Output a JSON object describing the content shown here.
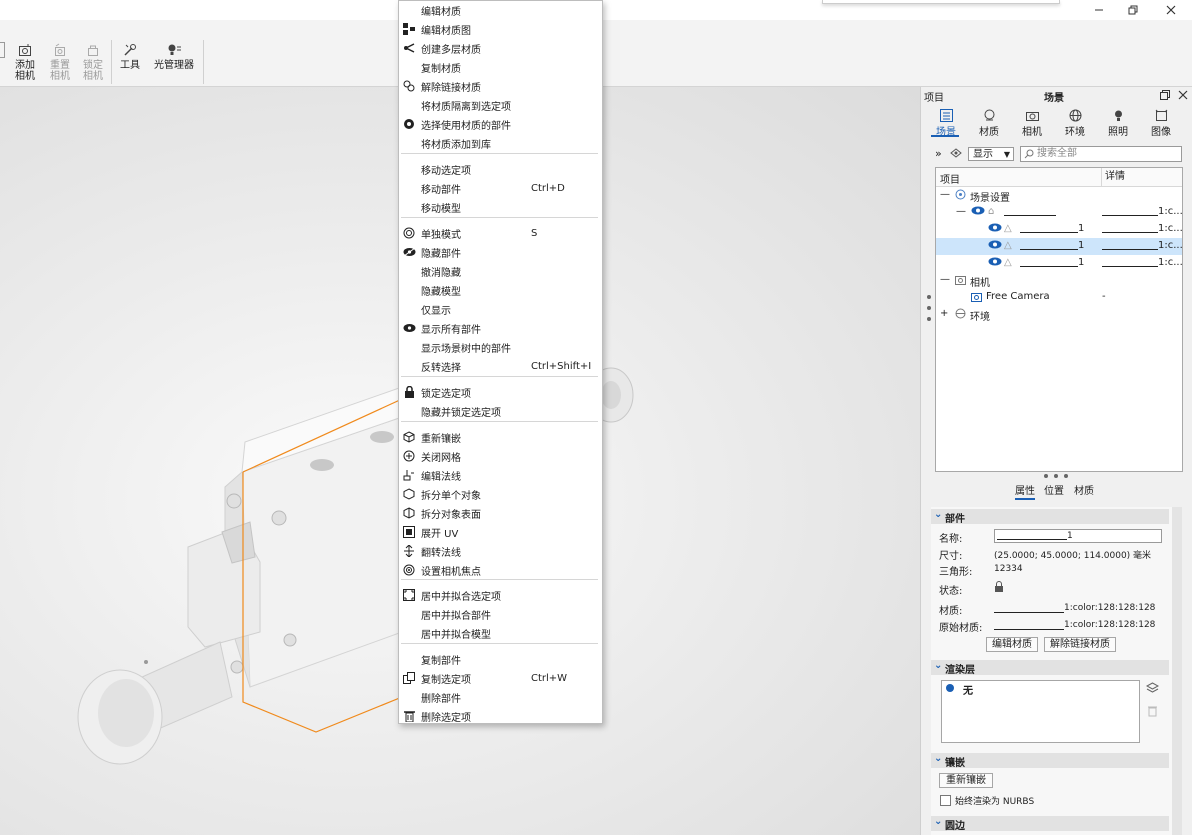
{
  "toolbar": {
    "buttons": [
      {
        "label": "添加相机",
        "icon": "add-camera-icon",
        "enabled": true
      },
      {
        "label": "重置相机",
        "icon": "reset-camera-icon",
        "enabled": false
      },
      {
        "label": "锁定相机",
        "icon": "lock-camera-icon",
        "enabled": false
      },
      {
        "label": "工具",
        "icon": "tools-icon",
        "enabled": true
      },
      {
        "label": "光管理器",
        "icon": "light-manager-icon",
        "enabled": true
      }
    ]
  },
  "context_menu": {
    "items": [
      {
        "label": "编辑材质",
        "icon": "",
        "shortcut": ""
      },
      {
        "label": "编辑材质图",
        "icon": "material-graph-icon",
        "shortcut": ""
      },
      {
        "label": "创建多层材质",
        "icon": "multilayer-icon",
        "shortcut": ""
      },
      {
        "label": "复制材质",
        "icon": "",
        "shortcut": ""
      },
      {
        "label": "解除链接材质",
        "icon": "unlink-material-icon",
        "shortcut": ""
      },
      {
        "label": "将材质隔离到选定项",
        "icon": "",
        "shortcut": ""
      },
      {
        "label": "选择使用材质的部件",
        "icon": "select-by-material-icon",
        "shortcut": ""
      },
      {
        "label": "将材质添加到库",
        "icon": "",
        "shortcut": ""
      },
      {
        "label": "移动选定项",
        "icon": "",
        "shortcut": ""
      },
      {
        "label": "移动部件",
        "icon": "",
        "shortcut": "Ctrl+D"
      },
      {
        "label": "移动模型",
        "icon": "",
        "shortcut": ""
      },
      {
        "label": "单独模式",
        "icon": "solo-mode-icon",
        "shortcut": "S"
      },
      {
        "label": "隐藏部件",
        "icon": "hide-eye-icon",
        "shortcut": ""
      },
      {
        "label": "撤消隐藏",
        "icon": "",
        "shortcut": ""
      },
      {
        "label": "隐藏模型",
        "icon": "",
        "shortcut": ""
      },
      {
        "label": "仅显示",
        "icon": "",
        "shortcut": ""
      },
      {
        "label": "显示所有部件",
        "icon": "eye-icon",
        "shortcut": ""
      },
      {
        "label": "显示场景树中的部件",
        "icon": "",
        "shortcut": ""
      },
      {
        "label": "反转选择",
        "icon": "",
        "shortcut": "Ctrl+Shift+I"
      },
      {
        "label": "锁定选定项",
        "icon": "lock-icon",
        "shortcut": ""
      },
      {
        "label": "隐藏并锁定选定项",
        "icon": "",
        "shortcut": ""
      },
      {
        "label": "重新镶嵌",
        "icon": "retessellate-icon",
        "shortcut": ""
      },
      {
        "label": "关闭网格",
        "icon": "close-mesh-icon",
        "shortcut": ""
      },
      {
        "label": "编辑法线",
        "icon": "edit-normals-icon",
        "shortcut": ""
      },
      {
        "label": "拆分单个对象",
        "icon": "split-object-icon",
        "shortcut": ""
      },
      {
        "label": "拆分对象表面",
        "icon": "split-surface-icon",
        "shortcut": ""
      },
      {
        "label": "展开 UV",
        "icon": "unwrap-uv-icon",
        "shortcut": ""
      },
      {
        "label": "翻转法线",
        "icon": "flip-normals-icon",
        "shortcut": ""
      },
      {
        "label": "设置相机焦点",
        "icon": "camera-focus-icon",
        "shortcut": ""
      },
      {
        "label": "居中并拟合选定项",
        "icon": "fit-selection-icon",
        "shortcut": ""
      },
      {
        "label": "居中并拟合部件",
        "icon": "",
        "shortcut": ""
      },
      {
        "label": "居中并拟合模型",
        "icon": "",
        "shortcut": ""
      },
      {
        "label": "复制部件",
        "icon": "",
        "shortcut": ""
      },
      {
        "label": "复制选定项",
        "icon": "duplicate-icon",
        "shortcut": "Ctrl+W"
      },
      {
        "label": "删除部件",
        "icon": "",
        "shortcut": ""
      },
      {
        "label": "删除选定项",
        "icon": "trash-icon",
        "shortcut": ""
      }
    ]
  },
  "panel": {
    "left_label": "项目",
    "title": "场景",
    "tabs": [
      {
        "label": "场景",
        "icon": "scene-list-icon",
        "active": true
      },
      {
        "label": "材质",
        "icon": "material-icon",
        "active": false
      },
      {
        "label": "相机",
        "icon": "camera-icon",
        "active": false
      },
      {
        "label": "环境",
        "icon": "environment-icon",
        "active": false
      },
      {
        "label": "照明",
        "icon": "lighting-icon",
        "active": false
      },
      {
        "label": "图像",
        "icon": "image-icon",
        "active": false
      }
    ],
    "filter": {
      "show_label": "显示",
      "search_placeholder": "搜索全部"
    },
    "tree": {
      "col_item": "项目",
      "col_detail": "详情",
      "rows": [
        {
          "label": "场景设置",
          "detail": ""
        },
        {
          "label": "",
          "detail": "1:c..."
        },
        {
          "label": "1",
          "detail": "1:c..."
        },
        {
          "label": "1",
          "detail": "1:c...",
          "selected": true
        },
        {
          "label": "1",
          "detail": "1:c..."
        },
        {
          "label": "相机",
          "detail": ""
        },
        {
          "label": "Free Camera",
          "detail": "-"
        },
        {
          "label": "环境",
          "detail": ""
        }
      ]
    },
    "subtabs": [
      "属性",
      "位置",
      "材质"
    ],
    "properties": {
      "section_part": "部件",
      "name_label": "名称:",
      "name_value": "1",
      "size_label": "尺寸:",
      "size_value": "(25.0000; 45.0000; 114.0000) 毫米",
      "tri_label": "三角形:",
      "tri_value": "12334",
      "state_label": "状态:",
      "material_label": "材质:",
      "material_value": "1:color:128:128:128",
      "orig_material_label": "原始材质:",
      "orig_material_value": "1:color:128:128:128",
      "edit_material_btn": "编辑材质",
      "unlink_material_btn": "解除链接材质",
      "section_render": "渲染层",
      "render_layer": "无",
      "section_tess": "镶嵌",
      "retess_btn": "重新镶嵌",
      "nurbs_checkbox": "始终渲染为 NURBS",
      "section_edge": "圆边"
    }
  }
}
